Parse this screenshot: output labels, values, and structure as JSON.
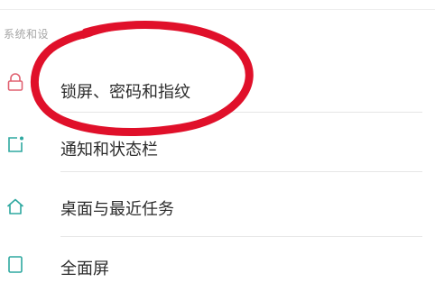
{
  "section": {
    "header": "系统和设"
  },
  "settings": {
    "items": [
      {
        "label": "锁屏、密码和指纹",
        "icon": "lock-icon"
      },
      {
        "label": "通知和状态栏",
        "icon": "notification-icon"
      },
      {
        "label": "桌面与最近任务",
        "icon": "home-icon"
      },
      {
        "label": "全面屏",
        "icon": "fullscreen-icon"
      }
    ]
  },
  "colors": {
    "lock_icon": "#e06070",
    "teal_icon": "#2ea8a0",
    "annotation": "#e0102a",
    "text": "#2b2b2b",
    "section_header": "#a6a6a6"
  }
}
